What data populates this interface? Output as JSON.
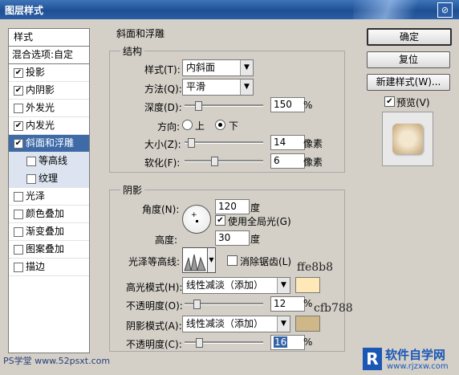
{
  "window": {
    "title": "图层样式",
    "help_label": "⊘"
  },
  "style_list": {
    "header": "样式",
    "blend": "混合选项:自定",
    "items": [
      {
        "label": "投影",
        "checked": true
      },
      {
        "label": "内阴影",
        "checked": true
      },
      {
        "label": "外发光",
        "checked": false
      },
      {
        "label": "内发光",
        "checked": true
      },
      {
        "label": "斜面和浮雕",
        "checked": true,
        "selected": true
      },
      {
        "label": "等高线",
        "checked": false,
        "sub": true
      },
      {
        "label": "纹理",
        "checked": false,
        "sub": true
      },
      {
        "label": "光泽",
        "checked": false
      },
      {
        "label": "颜色叠加",
        "checked": false
      },
      {
        "label": "渐变叠加",
        "checked": false
      },
      {
        "label": "图案叠加",
        "checked": false
      },
      {
        "label": "描边",
        "checked": false
      }
    ]
  },
  "bevel": {
    "section_title": "斜面和浮雕",
    "structure": {
      "title": "结构",
      "style_label": "样式(T):",
      "style_value": "内斜面",
      "technique_label": "方法(Q):",
      "technique_value": "平滑",
      "depth_label": "深度(D):",
      "depth_value": "150",
      "depth_unit": "%",
      "depth_level": 0.15,
      "direction_label": "方向:",
      "direction_up": "上",
      "direction_down": "下",
      "direction_selected": "down",
      "size_label": "大小(Z):",
      "size_value": "14",
      "size_unit": "像素",
      "size_level": 0.05,
      "soften_label": "软化(F):",
      "soften_value": "6",
      "soften_unit": "像素",
      "soften_level": 0.37
    },
    "shading": {
      "title": "阴影",
      "angle_label": "角度(N):",
      "angle_value": "120",
      "angle_unit": "度",
      "global_light_label": "使用全局光(G)",
      "global_light_checked": true,
      "altitude_label": "高度:",
      "altitude_value": "30",
      "altitude_unit": "度",
      "gloss_contour_label": "光泽等高线:",
      "antialias_label": "消除锯齿(L)",
      "antialias_checked": false,
      "highlight_mode_label": "高光模式(H):",
      "highlight_mode_value": "线性减淡（添加）",
      "highlight_color": "#ffe8b8",
      "highlight_opacity_label": "不透明度(O):",
      "highlight_opacity_value": "12",
      "highlight_opacity_unit": "%",
      "highlight_opacity_level": 0.12,
      "shadow_mode_label": "阴影模式(A):",
      "shadow_mode_value": "线性减淡（添加）",
      "shadow_color": "#cfb788",
      "shadow_opacity_label": "不透明度(C):",
      "shadow_opacity_value": "16",
      "shadow_opacity_unit": "%",
      "shadow_opacity_level": 0.16
    }
  },
  "annotations": {
    "highlight_hex": "ffe8b8",
    "shadow_hex": "cfb788"
  },
  "buttons": {
    "ok": "确定",
    "reset": "复位",
    "new_style": "新建样式(W)...",
    "preview_label": "预览(V)",
    "preview_checked": true
  },
  "watermarks": {
    "left": "PS学堂 www.52psxt.com",
    "logo_letter": "R",
    "logo_title": "软件自学网",
    "logo_url": "www.rjzxw.com"
  }
}
